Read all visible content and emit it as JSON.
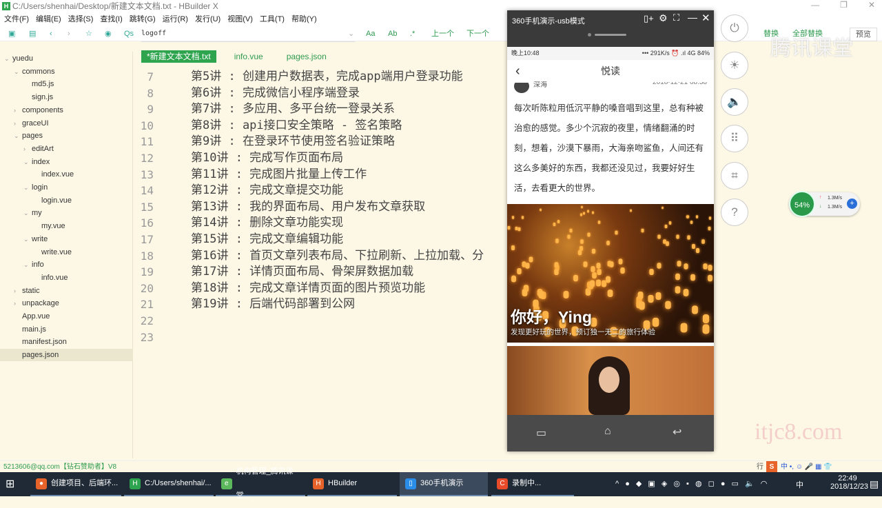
{
  "window": {
    "title": "C:/Users/shenhai/Desktop/新建文本文档.txt - HBuilder X",
    "logo": "H"
  },
  "menu": [
    "文件(F)",
    "编辑(E)",
    "选择(S)",
    "查找(I)",
    "跳转(G)",
    "运行(R)",
    "发行(U)",
    "视图(V)",
    "工具(T)",
    "帮助(Y)"
  ],
  "toolbar": {
    "search_value": "logoff",
    "prev": "上一个",
    "next": "下一个",
    "replace": "替换",
    "replace_all": "全部替换",
    "preview": "预览",
    "case_icon": "Aa",
    "word_icon": "Ab"
  },
  "sidebar": [
    {
      "label": "yuedu",
      "depth": 0,
      "chev": "⌄"
    },
    {
      "label": "commons",
      "depth": 1,
      "chev": "⌄"
    },
    {
      "label": "md5.js",
      "depth": 2,
      "chev": ""
    },
    {
      "label": "sign.js",
      "depth": 2,
      "chev": ""
    },
    {
      "label": "components",
      "depth": 1,
      "chev": "›"
    },
    {
      "label": "graceUI",
      "depth": 1,
      "chev": "›"
    },
    {
      "label": "pages",
      "depth": 1,
      "chev": "⌄"
    },
    {
      "label": "editArt",
      "depth": 2,
      "chev": "›"
    },
    {
      "label": "index",
      "depth": 2,
      "chev": "⌄"
    },
    {
      "label": "index.vue",
      "depth": 3,
      "chev": ""
    },
    {
      "label": "login",
      "depth": 2,
      "chev": "⌄"
    },
    {
      "label": "login.vue",
      "depth": 3,
      "chev": ""
    },
    {
      "label": "my",
      "depth": 2,
      "chev": "⌄"
    },
    {
      "label": "my.vue",
      "depth": 3,
      "chev": ""
    },
    {
      "label": "write",
      "depth": 2,
      "chev": "⌄"
    },
    {
      "label": "write.vue",
      "depth": 3,
      "chev": ""
    },
    {
      "label": "info",
      "depth": 2,
      "chev": "⌄"
    },
    {
      "label": "info.vue",
      "depth": 3,
      "chev": ""
    },
    {
      "label": "static",
      "depth": 1,
      "chev": "›"
    },
    {
      "label": "unpackage",
      "depth": 1,
      "chev": "›"
    },
    {
      "label": "App.vue",
      "depth": 1,
      "chev": ""
    },
    {
      "label": "main.js",
      "depth": 1,
      "chev": ""
    },
    {
      "label": "manifest.json",
      "depth": 1,
      "chev": ""
    },
    {
      "label": "pages.json",
      "depth": 1,
      "chev": "",
      "selected": true
    }
  ],
  "tabs": [
    {
      "label": "*新建文本文档.txt",
      "active": true
    },
    {
      "label": "info.vue"
    },
    {
      "label": "pages.json"
    }
  ],
  "editor_lines": [
    {
      "n": "7",
      "t": "第5讲 : 创建用户数据表，完成app端用户登录功能"
    },
    {
      "n": "8",
      "t": "第6讲 : 完成微信小程序端登录"
    },
    {
      "n": "9",
      "t": "第7讲 : 多应用、多平台统一登录关系"
    },
    {
      "n": "10",
      "t": "第8讲 : api接口安全策略 - 签名策略"
    },
    {
      "n": "11",
      "t": "第9讲 : 在登录环节使用签名验证策略"
    },
    {
      "n": "12",
      "t": "第10讲 : 完成写作页面布局"
    },
    {
      "n": "13",
      "t": "第11讲 : 完成图片批量上传工作"
    },
    {
      "n": "14",
      "t": "第12讲 : 完成文章提交功能"
    },
    {
      "n": "15",
      "t": "第13讲 : 我的界面布局、用户发布文章获取"
    },
    {
      "n": "16",
      "t": "第14讲 : 删除文章功能实现"
    },
    {
      "n": "17",
      "t": "第15讲 : 完成文章编辑功能"
    },
    {
      "n": "18",
      "t": "第16讲 : 首页文章列表布局、下拉刷新、上拉加载、分"
    },
    {
      "n": "19",
      "t": "第17讲 : 详情页面布局、骨架屏数据加载"
    },
    {
      "n": "20",
      "t": "第18讲 : 完成文章详情页面的图片预览功能"
    },
    {
      "n": "21",
      "t": "第19讲 : 后端代码部署到公网"
    },
    {
      "n": "22",
      "t": ""
    },
    {
      "n": "23",
      "t": ""
    }
  ],
  "phone": {
    "window_title": "360手机演示-usb模式",
    "status_time": "晚上10:48",
    "status_right": "••• 291K/s ⏰ .ıl 4G 84%",
    "nav_title": "悦读",
    "author": "深海",
    "date": "2018-12-21 08:38",
    "paragraph": "每次听陈粒用低沉平静的嗓音唱到这里，总有种被治愈的感觉。多少个沉寂的夜里，情绪翻涌的时刻，想着，沙漠下暴雨，大海亲吻鲨鱼，人间还有这么多美好的东西，我都还没见过，我要好好生活，去看更大的世界。",
    "banner_title": "你好，Ying",
    "banner_sub": "发现更好玩的世界，预订独一无二的旅行体验"
  },
  "net_widget": {
    "percent": "54%",
    "up": "1.3M/s",
    "down": "1.3M/s"
  },
  "watermarks": {
    "tencent": "腾讯课堂",
    "site": "itjc8.com"
  },
  "statusbar": {
    "text": "5213606@qq.com【钻石赞助者】V8",
    "row_label": "行"
  },
  "taskbar": {
    "items": [
      {
        "label": "创建项目、后端环...",
        "color": "#e8632a",
        "icon": "●"
      },
      {
        "label": "C:/Users/shenhai/...",
        "color": "#2ea44f",
        "icon": "H"
      },
      {
        "label": "机构管理_腾讯课堂...",
        "color": "#5cb85c",
        "icon": "e"
      },
      {
        "label": "HBuilder",
        "color": "#e8632a",
        "icon": "H"
      },
      {
        "label": "360手机演示",
        "color": "#2a8de8",
        "icon": "▯",
        "active": true
      },
      {
        "label": "录制中...",
        "color": "#e84a2a",
        "icon": "C"
      }
    ],
    "time": "22:49",
    "date": "2018/12/23",
    "ime": "中"
  }
}
